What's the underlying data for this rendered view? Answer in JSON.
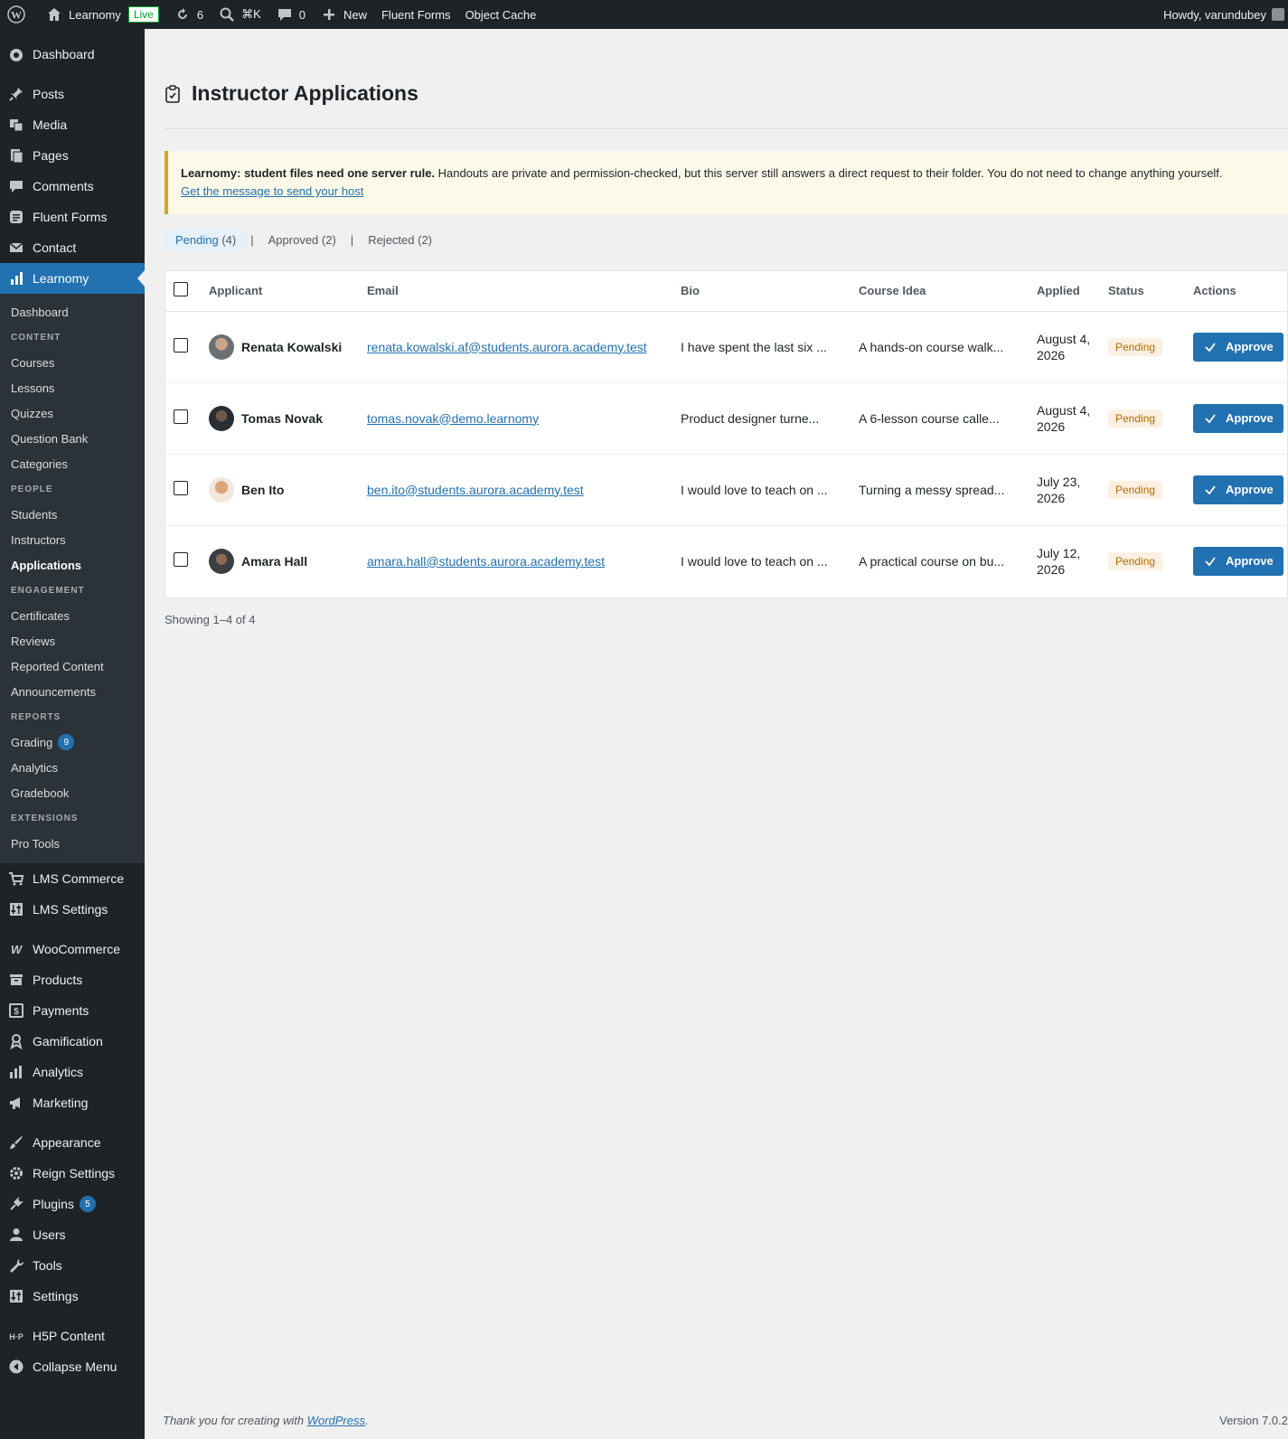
{
  "adminbar": {
    "site_name": "Learnomy",
    "live_label": "Live",
    "updates_count": "6",
    "search_shortcut": "⌘K",
    "comments_count": "0",
    "new_label": "New",
    "fluent_forms": "Fluent Forms",
    "object_cache": "Object Cache",
    "howdy": "Howdy, varundubey"
  },
  "sidebar": {
    "top_before": [
      {
        "label": "Dashboard",
        "icon": "dashboard-icon"
      },
      {
        "label": "Posts",
        "icon": "pin-icon"
      },
      {
        "label": "Media",
        "icon": "media-icon"
      },
      {
        "label": "Pages",
        "icon": "pages-icon"
      },
      {
        "label": "Comments",
        "icon": "comments-icon"
      },
      {
        "label": "Fluent Forms",
        "icon": "forms-icon"
      },
      {
        "label": "Contact",
        "icon": "mail-icon"
      }
    ],
    "current": {
      "label": "Learnomy",
      "icon": "chart-icon"
    },
    "submenu": {
      "dashboard": "Dashboard",
      "content_head": "CONTENT",
      "courses": "Courses",
      "lessons": "Lessons",
      "quizzes": "Quizzes",
      "question_bank": "Question Bank",
      "categories": "Categories",
      "people_head": "PEOPLE",
      "students": "Students",
      "instructors": "Instructors",
      "applications": "Applications",
      "engagement_head": "ENGAGEMENT",
      "certificates": "Certificates",
      "reviews": "Reviews",
      "reported_content": "Reported Content",
      "announcements": "Announcements",
      "reports_head": "REPORTS",
      "grading": "Grading",
      "grading_count": "9",
      "analytics": "Analytics",
      "gradebook": "Gradebook",
      "extensions_head": "EXTENSIONS",
      "pro_tools": "Pro Tools"
    },
    "lms_commerce": "LMS Commerce",
    "lms_settings": "LMS Settings",
    "woocommerce": "WooCommerce",
    "products": "Products",
    "payments": "Payments",
    "gamification": "Gamification",
    "analytics": "Analytics",
    "marketing": "Marketing",
    "appearance": "Appearance",
    "reign_settings": "Reign Settings",
    "plugins": "Plugins",
    "plugins_count": "5",
    "users": "Users",
    "tools": "Tools",
    "settings": "Settings",
    "h5p": "H5P Content",
    "collapse": "Collapse Menu"
  },
  "page": {
    "title": "Instructor Applications",
    "notice_bold": "Learnomy: student files need one server rule.",
    "notice_text": " Handouts are private and permission-checked, but this server still answers a direct request to their folder. You do not need to change anything yourself.",
    "notice_link": "Get the message to send your host",
    "filters": {
      "pending": "Pending",
      "pending_count": "(4)",
      "approved": "Approved",
      "approved_count": "(2)",
      "rejected": "Rejected",
      "rejected_count": "(2)",
      "sep": "|"
    },
    "columns": {
      "applicant": "Applicant",
      "email": "Email",
      "bio": "Bio",
      "course_idea": "Course Idea",
      "applied": "Applied",
      "status": "Status",
      "actions": "Actions"
    },
    "rows": [
      {
        "name": "Renata Kowalski",
        "email": "renata.kowalski.af@students.aurora.academy.test",
        "bio": "I have spent the last six ...",
        "idea": "A hands-on course walk...",
        "applied": "August 4, 2026",
        "status": "Pending",
        "action": "Approve"
      },
      {
        "name": "Tomas Novak",
        "email": "tomas.novak@demo.learnomy",
        "bio": "Product designer turne...",
        "idea": "A 6-lesson course calle...",
        "applied": "August 4, 2026",
        "status": "Pending",
        "action": "Approve"
      },
      {
        "name": "Ben Ito",
        "email": "ben.ito@students.aurora.academy.test",
        "bio": "I would love to teach on ...",
        "idea": "Turning a messy spread...",
        "applied": "July 23, 2026",
        "status": "Pending",
        "action": "Approve"
      },
      {
        "name": "Amara Hall",
        "email": "amara.hall@students.aurora.academy.test",
        "bio": "I would love to teach on ...",
        "idea": "A practical course on bu...",
        "applied": "July 12, 2026",
        "status": "Pending",
        "action": "Approve"
      }
    ],
    "showing": "Showing 1–4 of 4"
  },
  "footer": {
    "thanks": "Thank you for creating with ",
    "wp_link": "WordPress",
    "period": ".",
    "version": "Version 7.0.2"
  },
  "colors": {
    "admin_bg": "#1d2327",
    "accent": "#2271b1",
    "notice_border": "#dba617",
    "pending_text": "#b36b00"
  }
}
